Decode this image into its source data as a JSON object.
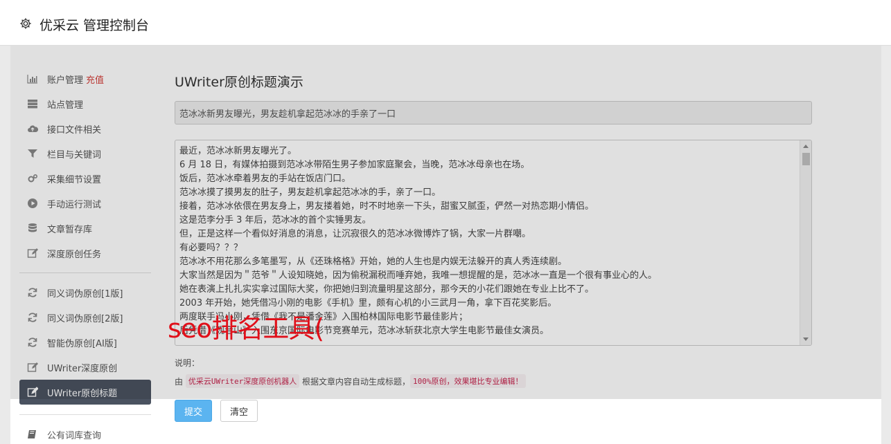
{
  "app": {
    "title": "优采云 管理控制台"
  },
  "sidebar": {
    "items": [
      {
        "label": "账户管理",
        "badge": "充值",
        "icon": "bar-chart-icon"
      },
      {
        "label": "站点管理",
        "icon": "server-icon"
      },
      {
        "label": "接口文件相关",
        "icon": "cloud-upload-icon"
      },
      {
        "label": "栏目与关键词",
        "icon": "filter-icon"
      },
      {
        "label": "采集细节设置",
        "icon": "gears-icon"
      },
      {
        "label": "手动运行测试",
        "icon": "play-circle-icon"
      },
      {
        "label": "文章暂存库",
        "icon": "database-icon"
      },
      {
        "label": "深度原创任务",
        "icon": "edit-icon"
      },
      {
        "label": "同义词伪原创[1版]",
        "icon": "refresh-icon"
      },
      {
        "label": "同义词伪原创[2版]",
        "icon": "refresh-icon"
      },
      {
        "label": "智能伪原创[AI版]",
        "icon": "refresh-icon"
      },
      {
        "label": "UWriter深度原创",
        "icon": "edit-icon"
      },
      {
        "label": "UWriter原创标题",
        "icon": "edit-icon"
      },
      {
        "label": "公有词库查询",
        "icon": "book-icon"
      }
    ]
  },
  "main": {
    "heading": "UWriter原创标题演示",
    "title_value": "范冰冰新男友曝光，男友趁机拿起范冰冰的手亲了一口",
    "content_lines": [
      "最近，范冰冰新男友曝光了。",
      "6 月 18 日，有媒体拍摄到范冰冰带陌生男子参加家庭聚会，当晚，范冰冰母亲也在场。",
      "饭后，范冰冰牵着男友的手站在饭店门口。",
      "范冰冰摸了摸男友的肚子，男友趁机拿起范冰冰的手，亲了一口。",
      "接着，范冰冰依偎在男友身上，男友搂着她，时不时地亲一下头，甜蜜又腻歪，俨然一对热恋期小情侣。",
      "这是范李分手 3 年后，范冰冰的首个实锤男友。",
      "但，正是这样一个看似好消息的消息，让沉寂很久的范冰冰微博炸了锅，大家一片群嘲。",
      "有必要吗？？？",
      "范冰冰不用花那么多笔墨写，从《还珠格格》开始，她的人生也是内娱无法躲开的真人秀连续剧。",
      "大家当然是因为＂范爷＂人设知晓她，因为偷税漏税而唾弃她，我唯一想提醒的是，范冰冰一直是一个很有事业心的人。",
      "她在表演上扎扎实实拿过国际大奖，你把她归到流量明星这部分，那今天的小花们跟她在专业上比不了。",
      "2003 年开始，她凭借冯小刚的电影《手机》里，颇有心机的小三武月一角，拿下百花奖影后。",
      "两度联手冯小刚，凭借《我不是潘金莲》入围柏林国际电影节最佳影片；",
      "后凭借《观音山》入围东京国际电影节竞赛单元，范冰冰斩获北京大学生电影节最佳女演员。"
    ],
    "note_label": "说明：",
    "note_prefix": "由",
    "note_code1": "优采云UWriter深度原创机器人",
    "note_mid": "根据文章内容自动生成标题，",
    "note_code2": "100%原创，效果堪比专业编辑！",
    "submit_label": "提交",
    "clear_label": "清空"
  },
  "watermark": "seo排名工具("
}
